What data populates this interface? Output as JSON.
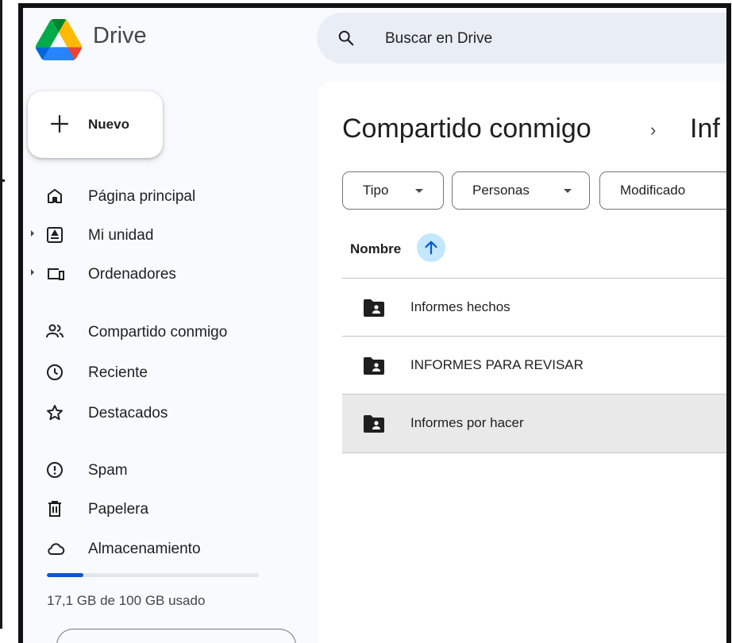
{
  "header": {
    "brand": "Drive",
    "search_placeholder": "Buscar en Drive"
  },
  "new_button": {
    "label": "Nuevo"
  },
  "sidebar": {
    "items": [
      {
        "label": "Página principal",
        "icon": "home-icon"
      },
      {
        "label": "Mi unidad",
        "icon": "drive-icon"
      },
      {
        "label": "Ordenadores",
        "icon": "computers-icon"
      },
      {
        "label": "Compartido conmigo",
        "icon": "shared-people-icon"
      },
      {
        "label": "Reciente",
        "icon": "clock-icon"
      },
      {
        "label": "Destacados",
        "icon": "star-icon"
      },
      {
        "label": "Spam",
        "icon": "spam-icon"
      },
      {
        "label": "Papelera",
        "icon": "trash-icon"
      },
      {
        "label": "Almacenamiento",
        "icon": "cloud-icon"
      }
    ],
    "storage": {
      "text": "17,1 GB de 100 GB usado",
      "used_fraction": 0.171,
      "bar_color": "#0b57d0"
    }
  },
  "breadcrumb": {
    "current": "Compartido conmigo",
    "separator": "›",
    "next": "Inf"
  },
  "filters": {
    "type": "Tipo",
    "people": "Personas",
    "modified": "Modificado"
  },
  "table": {
    "column_name": "Nombre",
    "sort": "ascending",
    "rows": [
      {
        "name": "Informes hechos",
        "icon": "shared-folder-icon"
      },
      {
        "name": "INFORMES PARA REVISAR",
        "icon": "shared-folder-icon"
      },
      {
        "name": "Informes por hacer",
        "icon": "shared-folder-icon",
        "selected": true
      }
    ]
  },
  "colors": {
    "accent": "#0b57d0",
    "search_bg": "#e9eef6",
    "sort_bg": "#c2e7ff",
    "selected_row": "#e9e9e9"
  }
}
